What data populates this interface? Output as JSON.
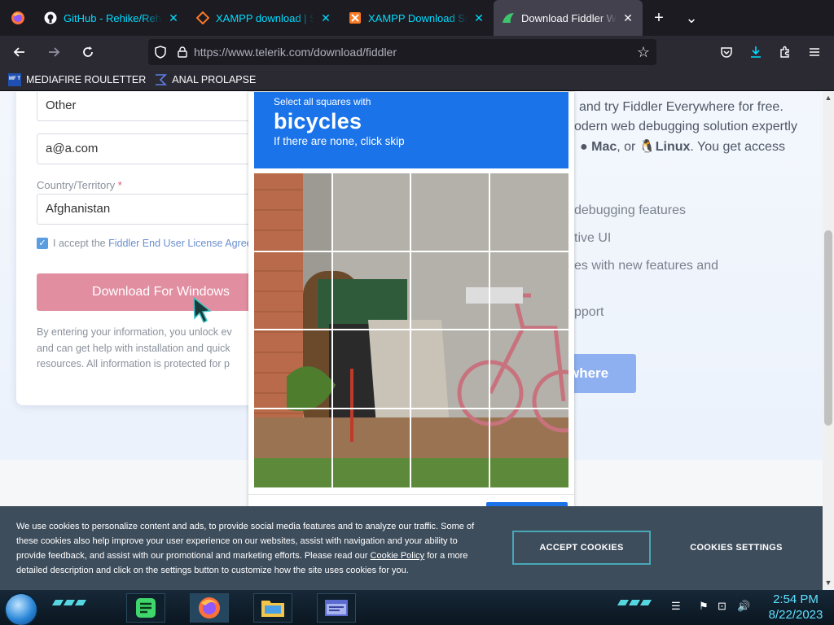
{
  "tabs": [
    {
      "title": "GitHub - Rehike/Rehike",
      "icon": "github-icon"
    },
    {
      "title": "XAMPP download | SourceForge",
      "icon": "xampp-icon"
    },
    {
      "title": "XAMPP Download Success",
      "icon": "xampp-icon"
    },
    {
      "title": "Download Fiddler Web Debugging",
      "icon": "fiddler-icon",
      "active": true
    }
  ],
  "tab_close_glyph": "✕",
  "new_tab_glyph": "+",
  "tab_list_glyph": "⌄",
  "url": "https://www.telerik.com/download/fiddler",
  "bookmarks": [
    {
      "label": "MEDIAFIRE ROULETTER",
      "icon": "mediafire-icon",
      "icon_text": "MF T"
    },
    {
      "label": "ANAL PROLAPSE",
      "icon": "bookmark-folder-icon"
    }
  ],
  "form": {
    "other_value": "Other",
    "email_value": "a@a.com",
    "country_label": "Country/Territory",
    "country_required": "*",
    "country_value": "Afghanistan",
    "accept_prefix": "I accept the",
    "accept_link": "Fiddler End User License Agree",
    "download_button": "Download For Windows",
    "disclaimer_lines": [
      "By entering your information, you unlock ev",
      "and can get help with installation and quick",
      "resources. All information is protected for p"
    ]
  },
  "right": {
    "line1": "and try Fiddler Everywhere for free.",
    "line2": "odern web debugging solution expertly",
    "line3_mac": "Mac",
    "line3_or": ", or",
    "line3_linux": "Linux",
    "line3_rest": ". You get access",
    "features": [
      "debugging features",
      "tive UI",
      "es with new features and",
      "pport"
    ],
    "everywhere_button": "where"
  },
  "captcha": {
    "instruction": "Select all squares with",
    "target": "bicycles",
    "hint": "If there are none, click skip",
    "grid_size": 4
  },
  "cookie": {
    "text_before": "We use cookies to personalize content and ads, to provide social media features and to analyze our traffic. Some of these cookies also help improve your user experience on our websites, assist with navigation and your ability to provide feedback, and assist with our promotional and marketing efforts. Please read our",
    "policy_link": "Cookie Policy",
    "text_after": "for a more detailed description and click on the settings button to customize how the site uses cookies for you.",
    "accept": "ACCEPT COOKIES",
    "settings": "COOKIES SETTINGS"
  },
  "clock": {
    "time": "2:54 PM",
    "date": "8/22/2023"
  },
  "colors": {
    "tab_bg": "#1c1b22",
    "toolbar_bg": "#2b2a33",
    "accent_teal": "#00ddff",
    "captcha_blue": "#1a73e8",
    "download_pink": "#e0859a",
    "cookie_bg": "#3e4d5c",
    "cookie_border": "#48a7b7",
    "clock": "#5fe1ff"
  }
}
